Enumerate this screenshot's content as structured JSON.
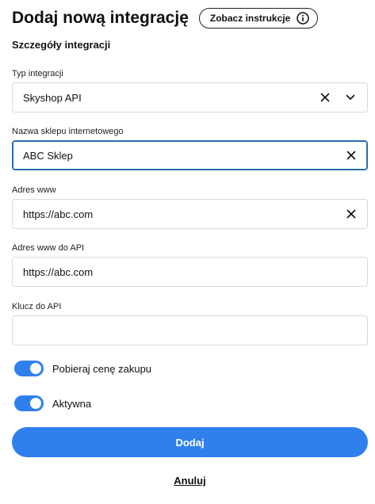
{
  "header": {
    "title": "Dodaj nową integrację",
    "instructions_label": "Zobacz instrukcje",
    "instructions_icon": "info-icon"
  },
  "section": {
    "title": "Szczegóły integracji"
  },
  "fields": {
    "type": {
      "label": "Typ integracji",
      "value": "Skyshop API",
      "icons": [
        "close-icon",
        "chevron-down-icon"
      ]
    },
    "shop_name": {
      "label": "Nazwa sklepu internetowego",
      "value": "ABC Sklep",
      "icons": [
        "close-icon"
      ]
    },
    "www": {
      "label": "Adres www",
      "value": "https://abc.com",
      "icons": [
        "close-icon"
      ]
    },
    "api_www": {
      "label": "Adres www do API",
      "value": "https://abc.com"
    },
    "api_key": {
      "label": "Klucz do API",
      "value": ""
    }
  },
  "toggles": {
    "purchase_price": {
      "label": "Pobieraj cenę zakupu",
      "on": true
    },
    "active": {
      "label": "Aktywna",
      "on": true
    }
  },
  "actions": {
    "submit_label": "Dodaj",
    "cancel_label": "Anuluj"
  },
  "colors": {
    "accent": "#2f80ed",
    "focus_border": "#2b6cb0",
    "border": "#d9d9d9",
    "text": "#111111"
  }
}
